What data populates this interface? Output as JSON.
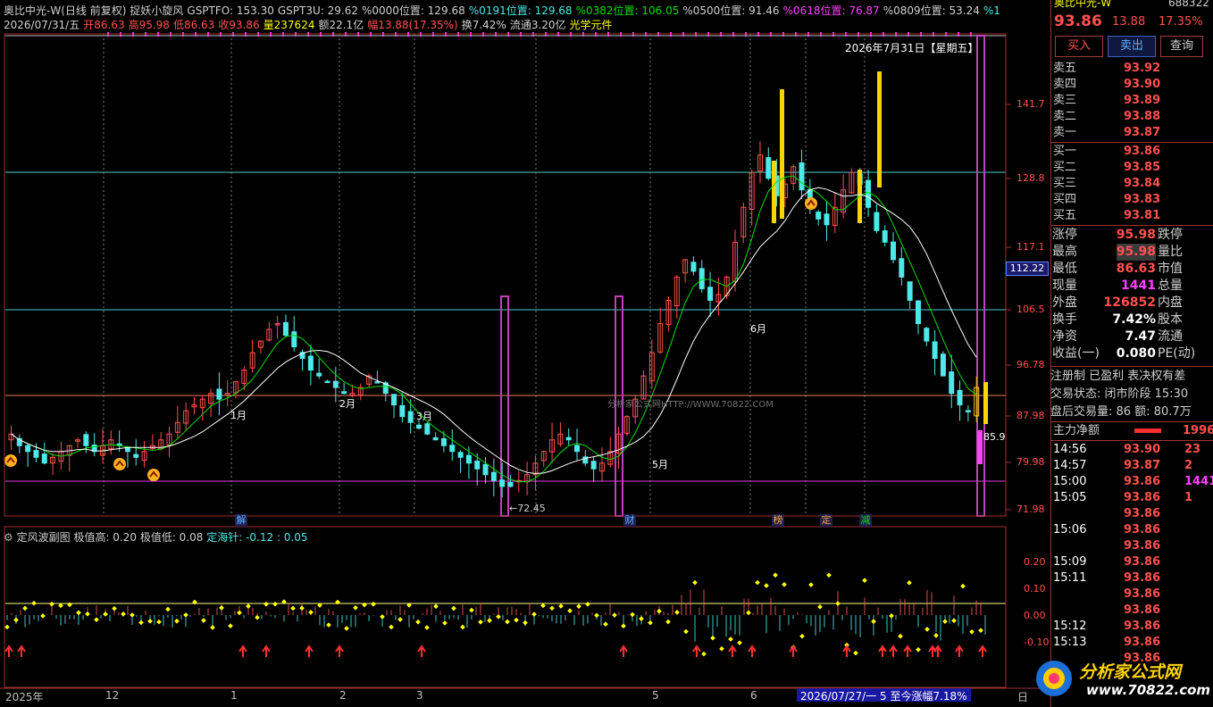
{
  "header": {
    "line1": [
      {
        "text": "奥比中光-W(日线 前复权)",
        "color": "#d0d0d0"
      },
      {
        "text": "捉妖小旋风",
        "color": "#d0d0d0"
      },
      {
        "text": "GSPTFO: 153.30",
        "color": "#d0d0d0"
      },
      {
        "text": "GSPT3U: 29.62",
        "color": "#d0d0d0"
      },
      {
        "text": "%0000位置: 129.68",
        "color": "#d0d0d0"
      },
      {
        "text": "%0191位置: 129.68",
        "color": "#4fe8e8"
      },
      {
        "text": "%0382位置: 106.05",
        "color": "#00e000"
      },
      {
        "text": "%0500位置: 91.46",
        "color": "#d0d0d0"
      },
      {
        "text": "%0618位置: 76.87",
        "color": "#ff40ff"
      },
      {
        "text": "%0809位置: 53.24",
        "color": "#d0d0d0"
      },
      {
        "text": "%1",
        "color": "#4fe8e8"
      }
    ],
    "line2": [
      {
        "text": "2026/07/31/五",
        "color": "#d0d0d0"
      },
      {
        "text": "开86.63",
        "color": "#ff5050"
      },
      {
        "text": "高95.98",
        "color": "#ff5050"
      },
      {
        "text": "低86.63",
        "color": "#ff5050"
      },
      {
        "text": "收93.86",
        "color": "#ff5050"
      },
      {
        "text": "量237624",
        "color": "#ffff00"
      },
      {
        "text": "额22.1亿",
        "color": "#d0d0d0"
      },
      {
        "text": "幅13.88(17.35%)",
        "color": "#ff5050"
      },
      {
        "text": "换7.42%",
        "color": "#d0d0d0"
      },
      {
        "text": "流通3.20亿",
        "color": "#d0d0d0"
      },
      {
        "text": "光学元件",
        "color": "#ffff00"
      }
    ]
  },
  "price_axis": [
    "141.7",
    "128.8",
    "117.1",
    "106.5",
    "96.78",
    "87.98",
    "79.98",
    "71.98"
  ],
  "price_axis_current": "112.22",
  "last_price_tag": "85.9",
  "date_overlay": "2026年7月31日【星期五】",
  "low_label": "72.45",
  "watermark_center": "分析家公式网HTTP://WWW.70822.COM",
  "month_markers": [
    "1月",
    "2月",
    "3月",
    "5月",
    "6月"
  ],
  "event_marks": [
    {
      "text": "解",
      "color": "#5fb0ff"
    },
    {
      "text": "财",
      "color": "#5fb0ff"
    },
    {
      "text": "榜",
      "color": "#ffa030"
    },
    {
      "text": "定",
      "color": "#ffa030"
    },
    {
      "text": "减",
      "color": "#00e000"
    }
  ],
  "sub_chart": {
    "title": "定风波副图",
    "params": "极值高: 0.20  极值低: 0.08",
    "needle": "定海针: -0.12 : 0.05",
    "axis": [
      "0.20",
      "0.10",
      "0.00",
      "-0.10"
    ]
  },
  "x_axis": [
    "2025年",
    "12",
    "1",
    "2",
    "3",
    "5",
    "6"
  ],
  "status_bar": "2026/07/27/一 5 至今涨幅7.18%",
  "scroll_label": "日",
  "right_panel": {
    "title": "奥比中光-W",
    "code": "688322",
    "price": "93.86",
    "change": "13.88",
    "change_pct": "17.35%",
    "buttons": [
      "买入",
      "卖出",
      "查询"
    ],
    "asks": [
      {
        "label": "卖五",
        "price": "93.92"
      },
      {
        "label": "卖四",
        "price": "93.90"
      },
      {
        "label": "卖三",
        "price": "93.89"
      },
      {
        "label": "卖二",
        "price": "93.88"
      },
      {
        "label": "卖一",
        "price": "93.87"
      }
    ],
    "bids": [
      {
        "label": "买一",
        "price": "93.86"
      },
      {
        "label": "买二",
        "price": "93.85"
      },
      {
        "label": "买三",
        "price": "93.84"
      },
      {
        "label": "买四",
        "price": "93.83"
      },
      {
        "label": "买五",
        "price": "93.81"
      }
    ],
    "stats": [
      {
        "label": "涨停",
        "value": "95.98",
        "label2": "跌停"
      },
      {
        "label": "最高",
        "value": "95.98",
        "label2": "量比"
      },
      {
        "label": "最低",
        "value": "86.63",
        "label2": "市值"
      },
      {
        "label": "现量",
        "value": "1441",
        "label2": "总量"
      },
      {
        "label": "外盘",
        "value": "126852",
        "label2": "内盘"
      },
      {
        "label": "换手",
        "value": "7.42%",
        "label2": "股本"
      },
      {
        "label": "净资",
        "value": "7.47",
        "label2": "流通"
      },
      {
        "label": "收益(一)",
        "value": "0.080",
        "label2": "PE(动)"
      }
    ],
    "info1": "注册制 已盈利 表决权有差",
    "info2": "交易状态: 闭市阶段 15:30",
    "info3": "盘后交易量: 86  额: 80.7万",
    "fund_label": "主力净额",
    "fund_value": "1996",
    "ticks": [
      {
        "time": "14:56",
        "price": "93.90",
        "vol": "23"
      },
      {
        "time": "14:57",
        "price": "93.87",
        "vol": "2"
      },
      {
        "time": "15:00",
        "price": "93.86",
        "vol": "1441"
      },
      {
        "time": "15:05",
        "price": "93.86",
        "vol": "1"
      },
      {
        "time": "",
        "price": "93.86",
        "vol": ""
      },
      {
        "time": "15:06",
        "price": "93.86",
        "vol": ""
      },
      {
        "time": "",
        "price": "93.86",
        "vol": ""
      },
      {
        "time": "15:09",
        "price": "93.86",
        "vol": ""
      },
      {
        "time": "15:11",
        "price": "93.86",
        "vol": ""
      },
      {
        "time": "",
        "price": "93.86",
        "vol": ""
      },
      {
        "time": "",
        "price": "93.86",
        "vol": ""
      },
      {
        "time": "15:12",
        "price": "93.86",
        "vol": ""
      },
      {
        "time": "15:13",
        "price": "93.86",
        "vol": ""
      },
      {
        "time": "",
        "price": "93.86",
        "vol": ""
      }
    ]
  },
  "brand_logo": {
    "name": "分析家公式网",
    "url": "www.70822.com"
  },
  "colors": {
    "up": "#ff5050",
    "down": "#4fe8e8",
    "ma5": "#ffffff",
    "ma10": "#00e000",
    "purple": "#c040c0"
  }
}
